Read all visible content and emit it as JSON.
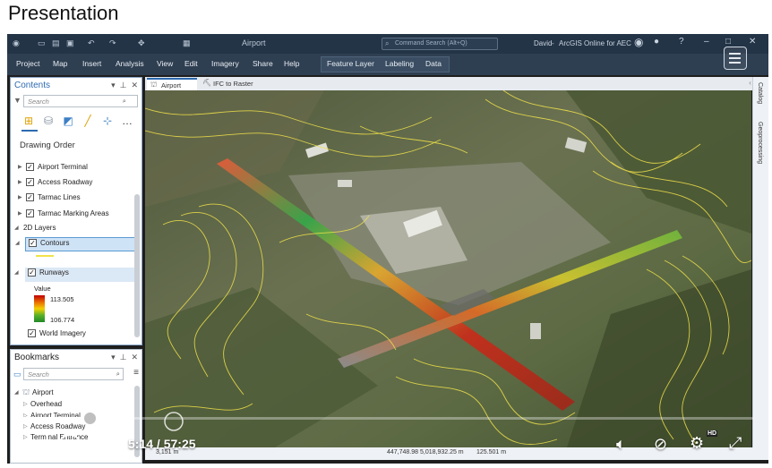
{
  "page": {
    "title": "Presentation"
  },
  "app": {
    "quick_access": "Airport",
    "command_search": "Command Search (Alt+Q)",
    "user": "David",
    "portal": "ArcGIS Online for AEC",
    "ribbon_tabs": [
      "Project",
      "Map",
      "Insert",
      "Analysis",
      "View",
      "Edit",
      "Imagery",
      "Share",
      "Help"
    ],
    "context_tabs": [
      "Feature Layer",
      "Labeling",
      "Data"
    ]
  },
  "contents": {
    "title": "Contents",
    "search_placeholder": "Search",
    "section": "Drawing Order",
    "layers": [
      {
        "label": "Airport Terminal",
        "checked": true
      },
      {
        "label": "Access Roadway",
        "checked": true
      },
      {
        "label": "Tarmac Lines",
        "checked": true
      },
      {
        "label": "Tarmac Marking Areas",
        "checked": true
      }
    ],
    "group_2d": "2D Layers",
    "contours": "Contours",
    "runways": "Runways",
    "value_label": "Value",
    "max_value": "113.505",
    "min_value": "106.774",
    "imagery": "World Imagery"
  },
  "bookmarks": {
    "title": "Bookmarks",
    "search_placeholder": "Search",
    "group": "Airport",
    "items": [
      "Overhead",
      "Airport Terminal",
      "Access Roadway",
      "Terminal Entrance"
    ]
  },
  "view_tabs": [
    "Airport",
    "IFC to Raster"
  ],
  "side_panels": [
    "Catalog",
    "Geoprocessing"
  ],
  "status": {
    "scale": "3,151 m",
    "coords": "447,748.98 5,018,932.25 m",
    "elev": "125.501 m"
  },
  "player": {
    "current_time": "5:14",
    "duration": "57:25",
    "progress": 0.0912,
    "skip_back": "10",
    "skip_forward": "10",
    "hd": "HD"
  },
  "colors": {
    "accent": "#2d6bb0",
    "ribbon": "#2f3f52",
    "titlebar": "#243447",
    "contour": "#f2e34a"
  }
}
